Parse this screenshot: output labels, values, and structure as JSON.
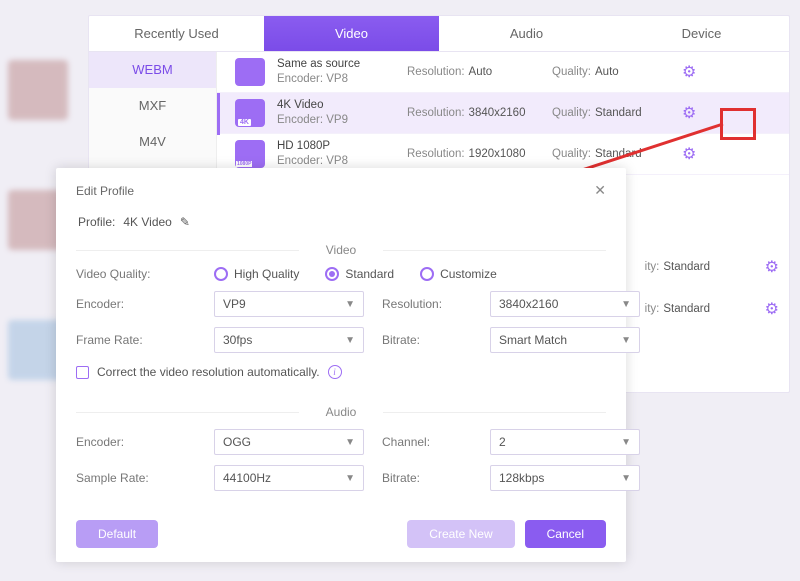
{
  "tabs": {
    "recently": "Recently Used",
    "video": "Video",
    "audio": "Audio",
    "device": "Device"
  },
  "sidebar": {
    "items": [
      "WEBM",
      "MXF",
      "M4V"
    ]
  },
  "profiles": [
    {
      "name": "Same as source",
      "encoder": "Encoder: VP8",
      "res_label": "Resolution:",
      "res": "Auto",
      "q_label": "Quality:",
      "q": "Auto"
    },
    {
      "name": "4K Video",
      "encoder": "Encoder: VP9",
      "res_label": "Resolution:",
      "res": "3840x2160",
      "q_label": "Quality:",
      "q": "Standard"
    },
    {
      "name": "HD 1080P",
      "encoder": "Encoder: VP8",
      "res_label": "Resolution:",
      "res": "1920x1080",
      "q_label": "Quality:",
      "q": "Standard"
    }
  ],
  "extra": [
    {
      "q_label": "ity:",
      "q": "Standard"
    },
    {
      "q_label": "ity:",
      "q": "Standard"
    }
  ],
  "dialog": {
    "title": "Edit Profile",
    "profile_label": "Profile:",
    "profile_value": "4K Video",
    "video_section": "Video",
    "audio_section": "Audio",
    "vq_label": "Video Quality:",
    "vq_high": "High Quality",
    "vq_standard": "Standard",
    "vq_custom": "Customize",
    "encoder_label": "Encoder:",
    "encoder_value": "VP9",
    "resolution_label": "Resolution:",
    "resolution_value": "3840x2160",
    "frame_label": "Frame Rate:",
    "frame_value": "30fps",
    "bitrate_label": "Bitrate:",
    "bitrate_value": "Smart Match",
    "auto_correct": "Correct the video resolution automatically.",
    "a_encoder_label": "Encoder:",
    "a_encoder_value": "OGG",
    "channel_label": "Channel:",
    "channel_value": "2",
    "sample_label": "Sample Rate:",
    "sample_value": "44100Hz",
    "a_bitrate_label": "Bitrate:",
    "a_bitrate_value": "128kbps",
    "btn_default": "Default",
    "btn_create": "Create New",
    "btn_cancel": "Cancel"
  }
}
